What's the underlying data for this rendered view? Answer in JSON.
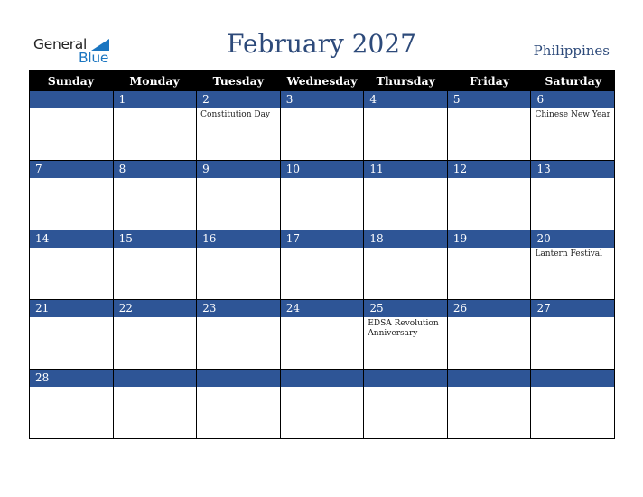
{
  "logo": {
    "general": "General",
    "blue": "Blue"
  },
  "title": "February 2027",
  "country": "Philippines",
  "weekdays": [
    "Sunday",
    "Monday",
    "Tuesday",
    "Wednesday",
    "Thursday",
    "Friday",
    "Saturday"
  ],
  "weeks": [
    [
      {
        "d": "",
        "e": ""
      },
      {
        "d": "1",
        "e": ""
      },
      {
        "d": "2",
        "e": "Constitution Day"
      },
      {
        "d": "3",
        "e": ""
      },
      {
        "d": "4",
        "e": ""
      },
      {
        "d": "5",
        "e": ""
      },
      {
        "d": "6",
        "e": "Chinese New Year"
      }
    ],
    [
      {
        "d": "7",
        "e": ""
      },
      {
        "d": "8",
        "e": ""
      },
      {
        "d": "9",
        "e": ""
      },
      {
        "d": "10",
        "e": ""
      },
      {
        "d": "11",
        "e": ""
      },
      {
        "d": "12",
        "e": ""
      },
      {
        "d": "13",
        "e": ""
      }
    ],
    [
      {
        "d": "14",
        "e": ""
      },
      {
        "d": "15",
        "e": ""
      },
      {
        "d": "16",
        "e": ""
      },
      {
        "d": "17",
        "e": ""
      },
      {
        "d": "18",
        "e": ""
      },
      {
        "d": "19",
        "e": ""
      },
      {
        "d": "20",
        "e": "Lantern Festival"
      }
    ],
    [
      {
        "d": "21",
        "e": ""
      },
      {
        "d": "22",
        "e": ""
      },
      {
        "d": "23",
        "e": ""
      },
      {
        "d": "24",
        "e": ""
      },
      {
        "d": "25",
        "e": "EDSA Revolution Anniversary"
      },
      {
        "d": "26",
        "e": ""
      },
      {
        "d": "27",
        "e": ""
      }
    ],
    [
      {
        "d": "28",
        "e": ""
      },
      {
        "d": "",
        "e": ""
      },
      {
        "d": "",
        "e": ""
      },
      {
        "d": "",
        "e": ""
      },
      {
        "d": "",
        "e": ""
      },
      {
        "d": "",
        "e": ""
      },
      {
        "d": "",
        "e": ""
      }
    ]
  ]
}
